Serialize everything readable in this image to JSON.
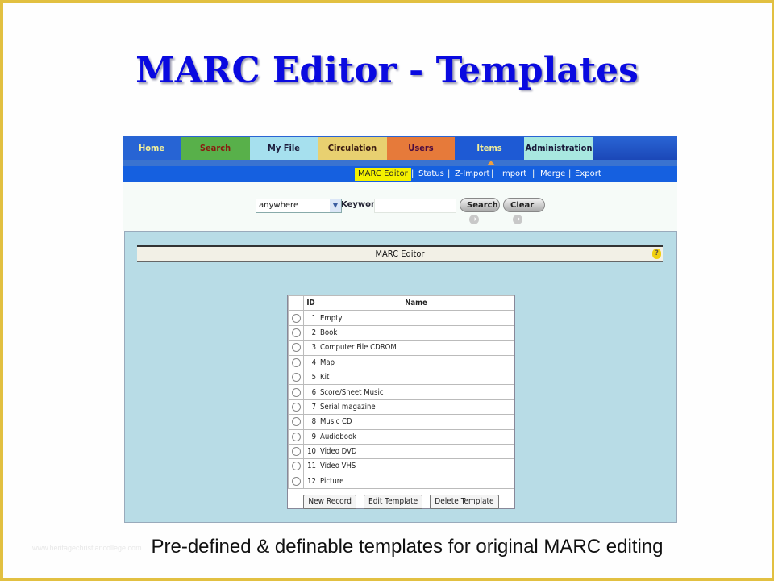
{
  "slide": {
    "title": "MARC Editor - Templates",
    "caption": "Pre-defined & definable templates for original MARC editing",
    "watermark": "www.heritagechristiancollege.com",
    "colors": {
      "frame": "#e2c041",
      "title": "#0a0ae0"
    }
  },
  "nav": {
    "tabs": [
      {
        "label": "Home",
        "color": "#2764d4",
        "text": "#f4f09a"
      },
      {
        "label": "Search",
        "color": "#58b04a",
        "text": "#8a1a10"
      },
      {
        "label": "My File",
        "color": "#a6e0ee",
        "text": "#1a1a3a"
      },
      {
        "label": "Circulation",
        "color": "#e8d070",
        "text": "#3a1a10"
      },
      {
        "label": "Users",
        "color": "#e67a3a",
        "text": "#4a0a40"
      },
      {
        "label": "Items",
        "color": "#1e5ad4",
        "text": "#f4f09a"
      },
      {
        "label": "Administration",
        "color": "#a8e8e0",
        "text": "#1a1a3a"
      }
    ],
    "active_tab": "Items",
    "subnav": [
      {
        "label": "MARC Editor",
        "active": true
      },
      {
        "label": "Status"
      },
      {
        "label": "Z-Import"
      },
      {
        "label": "Import"
      },
      {
        "label": "Merge"
      },
      {
        "label": "Export"
      }
    ]
  },
  "search": {
    "scope_selected": "anywhere",
    "keyword_label": "Keyword",
    "keyword_value": "",
    "search_label": "Search",
    "clear_label": "Clear"
  },
  "panel": {
    "title": "MARC Editor",
    "help_icon": "?",
    "table": {
      "columns": [
        "",
        "ID",
        "Name"
      ],
      "rows": [
        {
          "id": "1",
          "name": "Empty"
        },
        {
          "id": "2",
          "name": "Book"
        },
        {
          "id": "3",
          "name": "Computer File CDROM"
        },
        {
          "id": "4",
          "name": "Map"
        },
        {
          "id": "5",
          "name": "Kit"
        },
        {
          "id": "6",
          "name": "Score/Sheet Music"
        },
        {
          "id": "7",
          "name": "Serial magazine"
        },
        {
          "id": "8",
          "name": "Music CD"
        },
        {
          "id": "9",
          "name": "Audiobook"
        },
        {
          "id": "10",
          "name": "Video DVD"
        },
        {
          "id": "11",
          "name": "Video VHS"
        },
        {
          "id": "12",
          "name": "Picture"
        }
      ]
    },
    "buttons": {
      "new_record": "New Record",
      "edit_template": "Edit Template",
      "delete_template": "Delete Template"
    }
  }
}
